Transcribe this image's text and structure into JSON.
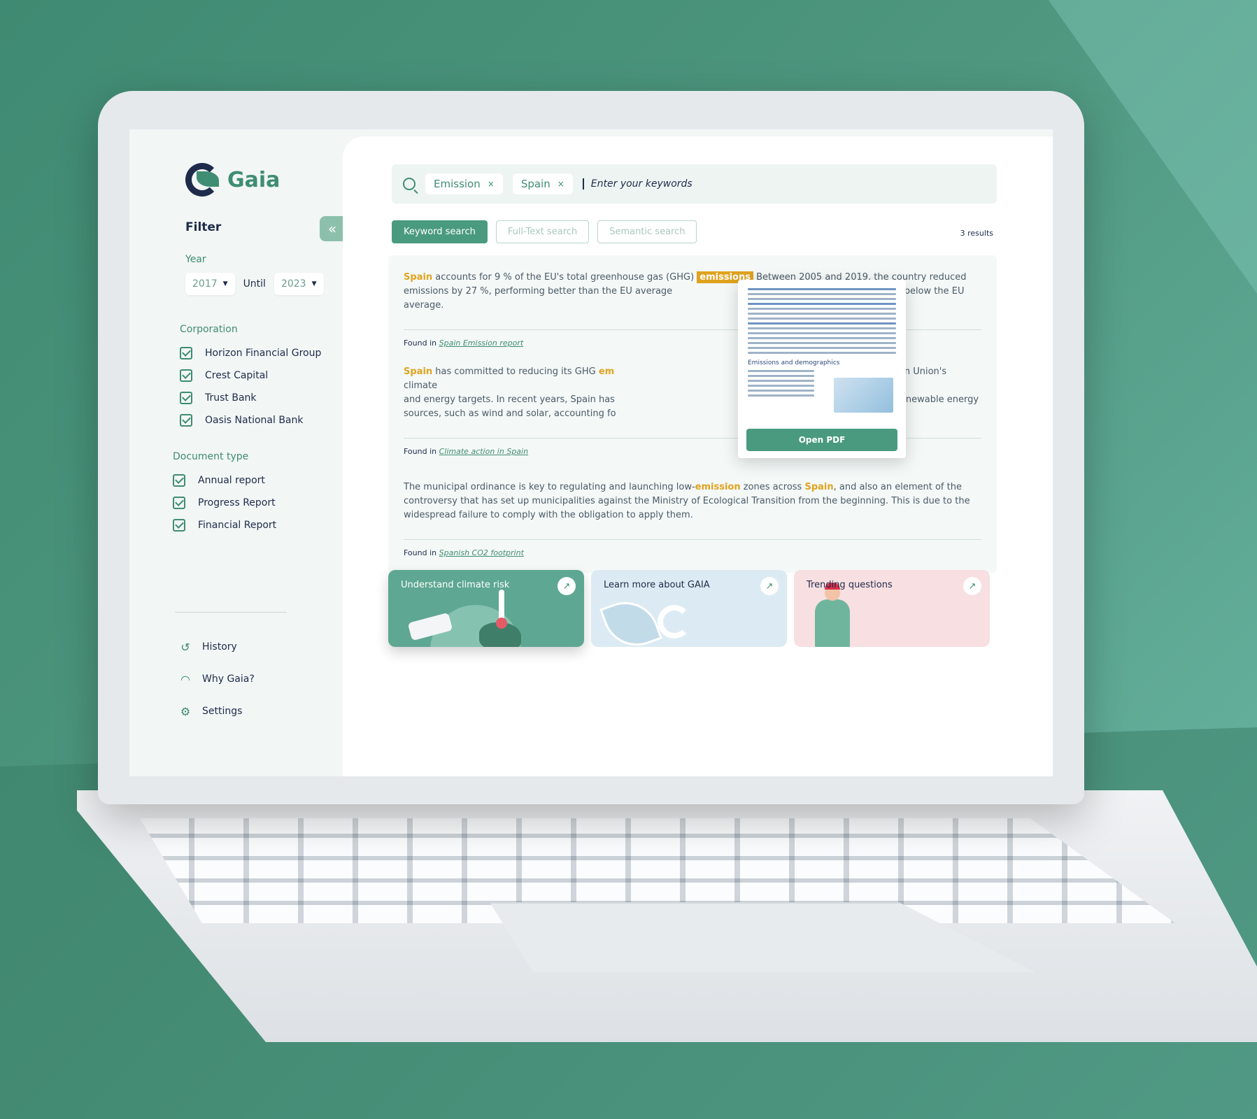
{
  "app": {
    "brand": "Gaia",
    "filter_title": "Filter",
    "collapse_icon": "double-chevron-left-icon"
  },
  "filters": {
    "year_label": "Year",
    "year_from": "2017",
    "until_label": "Until",
    "year_to": "2023",
    "corporation_label": "Corporation",
    "corporations": [
      "Horizon Financial Group",
      "Crest Capital",
      "Trust Bank",
      "Oasis National Bank"
    ],
    "document_type_label": "Document type",
    "document_types": [
      "Annual report",
      "Progress Report",
      "Financial Report"
    ]
  },
  "nav": {
    "history": "History",
    "why_gaia": "Why Gaia?",
    "settings": "Settings"
  },
  "search": {
    "chips": [
      "Emission",
      "Spain"
    ],
    "chip_remove": "×",
    "placeholder": "Enter your keywords"
  },
  "tabs": {
    "keyword": "Keyword search",
    "fulltext": "Full-Text search",
    "semantic": "Semantic search"
  },
  "results_count": "3 results",
  "results": [
    {
      "kw1": "Spain",
      "text1": " accounts for 9 % of the EU's total greenhouse gas (GHG) ",
      "kw2": "emissions",
      "text2": " Between 2005 and 2019, the country reduced emissions by 27 %, performing better than the EU average",
      "text3": "y is slightly below the EU average.",
      "found_label": "Found in",
      "source": "Spain Emission report"
    },
    {
      "kw1": "Spain",
      "text1": " has committed to reducing its GHG ",
      "kw2": "em",
      "text2": "and energy targets. In recent years, Spain has",
      "text3": "sources, such as wind and solar, accounting fo",
      "text4": "s, as part of the European Union's climate",
      "text5": "electricity sector, with renewable energy",
      "found_label": "Found in",
      "source": "Climate action in Spain"
    },
    {
      "text1": "The municipal ordinance is key to regulating and launching low-",
      "kw1": "emission",
      "text2": " zones across ",
      "kw2": "Spain",
      "text3": ", and also an element of the controversy that has set up municipalities against the Ministry of Ecological Transition from the beginning. This is due to the widespread failure to comply with the obligation to apply them.",
      "found_label": "Found in",
      "source": "Spanish CO2 footprint"
    }
  ],
  "pdf_preview": {
    "heading": "Emissions and demographics",
    "button": "Open PDF"
  },
  "promos": [
    {
      "title": "Understand climate risk",
      "icon": "arrow-up-right-icon"
    },
    {
      "title": "Learn more about GAIA",
      "icon": "arrow-up-right-icon"
    },
    {
      "title": "Trending questions",
      "icon": "arrow-up-right-icon"
    }
  ],
  "colors": {
    "brand_green": "#3f8d72",
    "navy": "#1e2b4a",
    "keyword_highlight": "#e0a31f",
    "background": "#4f977f"
  }
}
